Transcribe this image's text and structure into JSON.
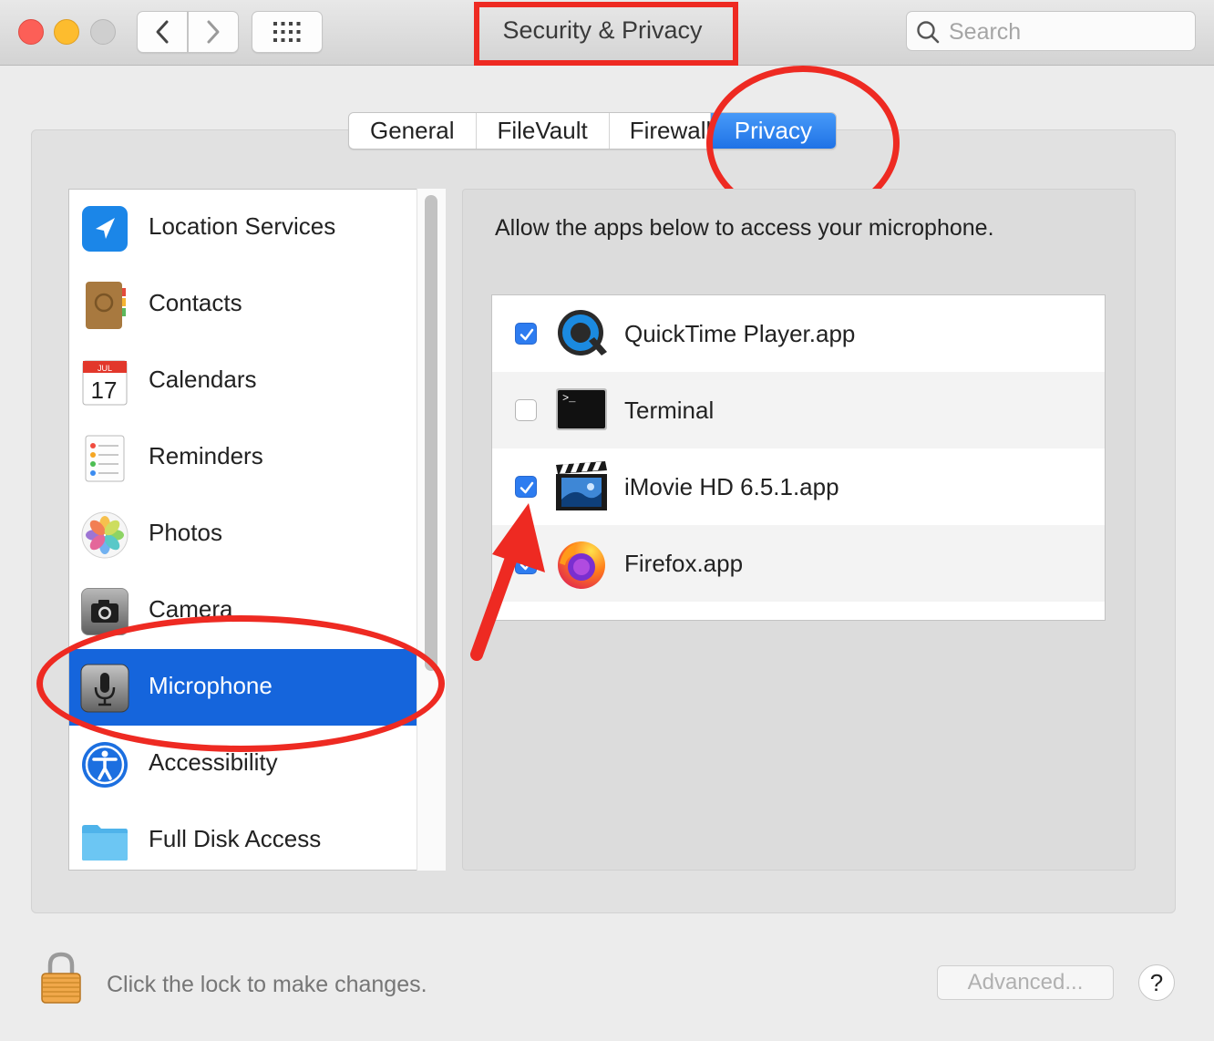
{
  "window": {
    "title": "Security & Privacy",
    "search_placeholder": "Search"
  },
  "tabs": [
    {
      "label": "General",
      "active": false
    },
    {
      "label": "FileVault",
      "active": false
    },
    {
      "label": "Firewall",
      "active": false
    },
    {
      "label": "Privacy",
      "active": true
    }
  ],
  "sidebar": {
    "items": [
      {
        "label": "Location Services",
        "icon": "location-arrow-icon",
        "selected": false
      },
      {
        "label": "Contacts",
        "icon": "contacts-book-icon",
        "selected": false
      },
      {
        "label": "Calendars",
        "icon": "calendar-icon",
        "selected": false,
        "icon_month": "JUL",
        "icon_day": "17"
      },
      {
        "label": "Reminders",
        "icon": "reminders-list-icon",
        "selected": false
      },
      {
        "label": "Photos",
        "icon": "photos-flower-icon",
        "selected": false
      },
      {
        "label": "Camera",
        "icon": "camera-icon",
        "selected": false
      },
      {
        "label": "Microphone",
        "icon": "microphone-icon",
        "selected": true
      },
      {
        "label": "Accessibility",
        "icon": "accessibility-icon",
        "selected": false
      },
      {
        "label": "Full Disk Access",
        "icon": "folder-icon",
        "selected": false
      }
    ]
  },
  "content": {
    "description": "Allow the apps below to access your microphone.",
    "apps": [
      {
        "name": "QuickTime Player.app",
        "checked": true,
        "icon": "quicktime-icon"
      },
      {
        "name": "Terminal",
        "checked": false,
        "icon": "terminal-icon"
      },
      {
        "name": "iMovie HD 6.5.1.app",
        "checked": true,
        "icon": "imovie-icon"
      },
      {
        "name": "Firefox.app",
        "checked": true,
        "icon": "firefox-icon"
      }
    ]
  },
  "footer": {
    "lock_text": "Click the lock to make changes.",
    "advanced_label": "Advanced...",
    "help_label": "?"
  },
  "colors": {
    "accent": "#1565dc",
    "annotation": "#ee2a22"
  }
}
